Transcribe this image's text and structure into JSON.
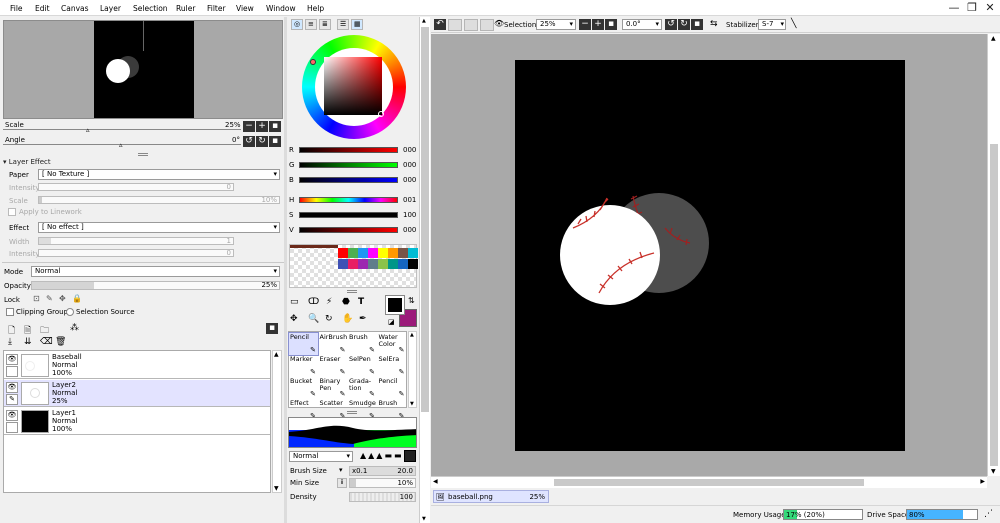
{
  "menu": [
    "File",
    "Edit",
    "Canvas",
    "Layer",
    "Selection",
    "Ruler",
    "Filter",
    "View",
    "Window",
    "Help"
  ],
  "window_controls": {
    "minimize": "—",
    "restore": "❐",
    "close": "✕"
  },
  "navigator": {
    "scale_label": "Scale",
    "scale_value": "25%",
    "angle_label": "Angle",
    "angle_value": "0°"
  },
  "layer_effect": {
    "header": "Layer Effect",
    "paper_label": "Paper",
    "paper_value": "[ No Texture ]",
    "intensity_label": "Intensity",
    "intensity_value": "0",
    "scale_label": "Scale",
    "scale_value": "10%",
    "apply_label": "Apply to Linework",
    "effect_label": "Effect",
    "effect_value": "[ No effect ]",
    "width_label": "Width",
    "width_value": "1",
    "intensity2_label": "Intensity",
    "intensity2_value": "0"
  },
  "layer_props": {
    "mode_label": "Mode",
    "mode_value": "Normal",
    "opacity_label": "Opacity",
    "opacity_value": "25%",
    "lock_label": "Lock",
    "clipping_label": "Clipping Group",
    "selection_source_label": "Selection Source"
  },
  "layers": [
    {
      "name": "Baseball",
      "mode": "Normal",
      "opacity": "100%",
      "selected": false
    },
    {
      "name": "Layer2",
      "mode": "Normal",
      "opacity": "25%",
      "selected": true
    },
    {
      "name": "Layer1",
      "mode": "Normal",
      "opacity": "100%",
      "selected": false
    }
  ],
  "color": {
    "rgb": [
      {
        "label": "R",
        "value": "000"
      },
      {
        "label": "G",
        "value": "000"
      },
      {
        "label": "B",
        "value": "000"
      }
    ],
    "hsv": [
      {
        "label": "H",
        "value": "001"
      },
      {
        "label": "S",
        "value": "100"
      },
      {
        "label": "V",
        "value": "000"
      }
    ],
    "primary": "#000000",
    "secondary": "#9b1b7a"
  },
  "swatches": [
    "#ff0000",
    "#4caf50",
    "#2196f3",
    "#ff00ff",
    "#ffff00",
    "#ff9800",
    "#795548",
    "#00bcd4",
    "#3f51b5",
    "#e91e63",
    "#9c27b0",
    "#607d8b",
    "#8bc34a",
    "#009688",
    "#1565c0",
    "#000000"
  ],
  "tools": [
    {
      "label": "Pencil",
      "icon": "pencil-icon",
      "active": true
    },
    {
      "label": "AirBrush",
      "icon": "airbrush-icon",
      "active": false
    },
    {
      "label": "Brush",
      "icon": "brush-icon",
      "active": false
    },
    {
      "label": "Water Color",
      "icon": "watercolor-icon",
      "active": false
    },
    {
      "label": "Marker",
      "icon": "marker-icon",
      "active": false
    },
    {
      "label": "Eraser",
      "icon": "eraser-icon",
      "active": false
    },
    {
      "label": "SelPen",
      "icon": "selpen-icon",
      "active": false
    },
    {
      "label": "SelEra",
      "icon": "selera-icon",
      "active": false
    },
    {
      "label": "Bucket",
      "icon": "bucket-icon",
      "active": false
    },
    {
      "label": "Binary Pen",
      "icon": "binary-pen-icon",
      "active": false
    },
    {
      "label": "Grada-tion",
      "icon": "gradation-icon",
      "active": false
    },
    {
      "label": "Pencil",
      "icon": "pencil2-icon",
      "active": false
    },
    {
      "label": "Effect",
      "icon": "effect-icon",
      "active": false
    },
    {
      "label": "Scatter",
      "icon": "scatter-icon",
      "active": false
    },
    {
      "label": "Smudge",
      "icon": "smudge-icon",
      "active": false
    },
    {
      "label": "Brush",
      "icon": "brush2-icon",
      "active": false
    }
  ],
  "brush": {
    "mode_value": "Normal",
    "size_label": "Brush Size",
    "size_mult": "x0.1",
    "size_value": "20.0",
    "min_label": "Min Size",
    "min_value": "10%",
    "density_label": "Density",
    "density_value": "100"
  },
  "canvas_toolbar": {
    "selection_label": "Selection",
    "zoom_value": "25%",
    "angle_value": "0.0°",
    "stabilizer_label": "Stabilizer",
    "stabilizer_value": "S-7"
  },
  "tab": {
    "name": "baseball.png",
    "zoom": "25%"
  },
  "status": {
    "memory_label": "Memory Usage",
    "memory_value": "17% (20%)",
    "memory_fraction": 0.17,
    "drive_label": "Drive Space",
    "drive_value": "80%",
    "drive_fraction": 0.8
  }
}
